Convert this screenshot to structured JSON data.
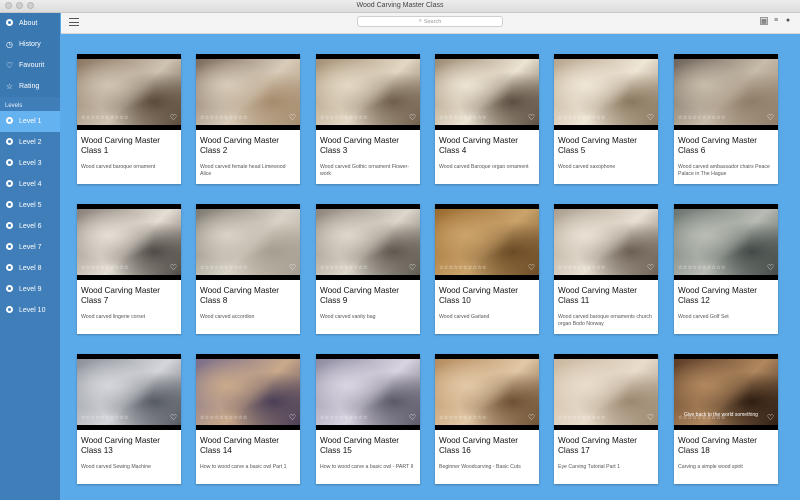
{
  "window": {
    "title": "Wood Carving Master Class"
  },
  "toolbar": {
    "search_placeholder": "Search"
  },
  "sidebar": {
    "top_items": [
      {
        "label": "About",
        "icon": "info-icon"
      },
      {
        "label": "History",
        "icon": "clock-icon"
      },
      {
        "label": "Favourit",
        "icon": "heart-icon"
      },
      {
        "label": "Rating",
        "icon": "star-icon"
      }
    ],
    "section_label": "Levels",
    "levels": [
      "Level 1",
      "Level 2",
      "Level 3",
      "Level 4",
      "Level 5",
      "Level 6",
      "Level 7",
      "Level 8",
      "Level 9",
      "Level 10"
    ],
    "active_level": "Level 1"
  },
  "colors": {
    "accent": "#5aa9e8",
    "sidebar": "#3f7eb8",
    "active": "#64b2f0"
  },
  "cards": [
    {
      "title": "Wood Carving Master Class 1",
      "subtitle": "Wood carved baroque ornament",
      "stars": "☆☆☆☆☆☆☆☆☆☆"
    },
    {
      "title": "Wood Carving Master Class 2",
      "subtitle": "Wood carved  female head Limewood Alice",
      "stars": "☆☆☆☆☆☆☆☆☆☆"
    },
    {
      "title": "Wood Carving Master Class 3",
      "subtitle": "Wood carved Gothic ornament Flower-work",
      "stars": "☆☆☆☆☆☆☆☆☆☆"
    },
    {
      "title": "Wood Carving Master Class 4",
      "subtitle": "Wood carved Baroque organ ornament",
      "stars": "☆☆☆☆☆☆☆☆☆☆"
    },
    {
      "title": "Wood Carving Master Class 5",
      "subtitle": "Wood carved saxophone",
      "stars": "☆☆☆☆☆☆☆☆☆☆"
    },
    {
      "title": "Wood Carving Master Class 6",
      "subtitle": "Wood carved ambassador chairs Peace Palace in The Hague",
      "stars": "☆☆☆☆☆☆☆☆☆☆"
    },
    {
      "title": "Wood Carving Master Class 7",
      "subtitle": "Wood carved lingerie corset",
      "stars": "☆☆☆☆☆☆☆☆☆☆"
    },
    {
      "title": "Wood Carving Master Class 8",
      "subtitle": "Wood carved accordion",
      "stars": "☆☆☆☆☆☆☆☆☆☆"
    },
    {
      "title": "Wood Carving Master Class 9",
      "subtitle": "Wood carved vanity bag",
      "stars": "☆☆☆☆☆☆☆☆☆☆"
    },
    {
      "title": "Wood Carving Master Class 10",
      "subtitle": "Wood carved Garland",
      "stars": "☆☆☆☆☆☆☆☆☆☆"
    },
    {
      "title": "Wood Carving Master Class 11",
      "subtitle": "Wood carved baroque ornaments church organ Bodo Norway",
      "stars": "☆☆☆☆☆☆☆☆☆☆"
    },
    {
      "title": "Wood Carving Master Class 12",
      "subtitle": "Wood carved Golf Set",
      "stars": "☆☆☆☆☆☆☆☆☆☆"
    },
    {
      "title": "Wood Carving Master Class 13",
      "subtitle": "Wood carved Sewing Machine",
      "stars": "☆☆☆☆☆☆☆☆☆☆"
    },
    {
      "title": "Wood Carving Master Class 14",
      "subtitle": "How to wood carve a basic owl Part 1",
      "stars": "☆☆☆☆☆☆☆☆☆☆"
    },
    {
      "title": "Wood Carving Master Class 15",
      "subtitle": "How to wood carve a basic owl - PART II",
      "stars": "☆☆☆☆☆☆☆☆☆☆"
    },
    {
      "title": "Wood Carving Master Class 16",
      "subtitle": "Beginner Woodcarving - Basic Cuts",
      "stars": "☆☆☆☆☆☆☆☆☆☆"
    },
    {
      "title": "Wood Carving Master Class 17",
      "subtitle": "Eye Carving Tutorial Part 1",
      "stars": "☆☆☆☆☆☆☆☆☆☆"
    },
    {
      "title": "Wood Carving Master Class 18",
      "subtitle": "Carving a simple wood spirit",
      "stars": "☆☆☆☆☆☆☆☆☆☆",
      "overlay": "Give back to the world something"
    }
  ]
}
